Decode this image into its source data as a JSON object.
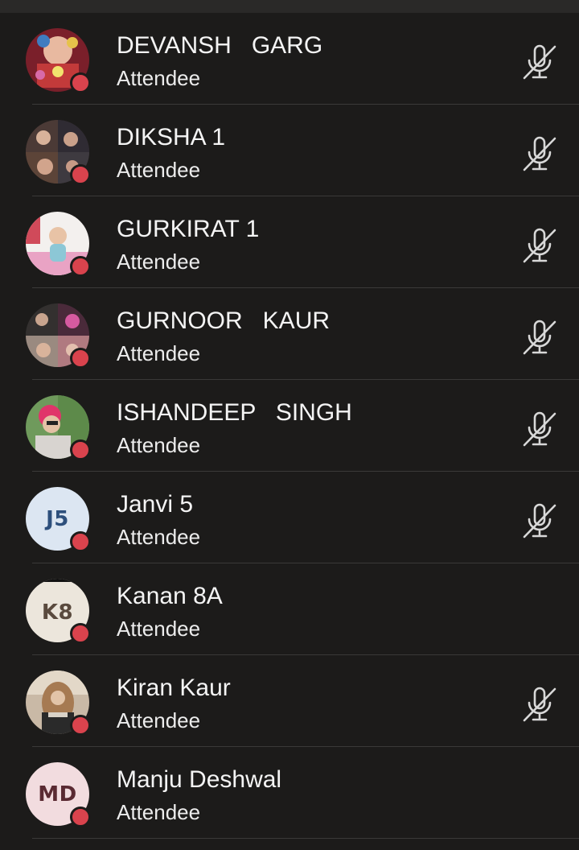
{
  "participants": [
    {
      "name": "DEVANSH   GARG",
      "role": "Attendee",
      "avatar": "photo",
      "status": "red",
      "mic": "mic-off-icon"
    },
    {
      "name": "DIKSHA 1",
      "role": "Attendee",
      "avatar": "photo",
      "status": "red",
      "mic": "mic-off-icon"
    },
    {
      "name": "GURKIRAT 1",
      "role": "Attendee",
      "avatar": "photo",
      "status": "red",
      "mic": "mic-off-icon"
    },
    {
      "name": "GURNOOR   KAUR",
      "role": "Attendee",
      "avatar": "photo",
      "status": "red",
      "mic": "mic-off-icon"
    },
    {
      "name": "ISHANDEEP   SINGH",
      "role": "Attendee",
      "avatar": "photo",
      "status": "red",
      "mic": "mic-off-icon"
    },
    {
      "name": "Janvi 5",
      "role": "Attendee",
      "initials": "J5",
      "initials_bg": "#dce6f2",
      "initials_color": "#2d4f7c",
      "status": "red",
      "mic": "mic-off-icon"
    },
    {
      "name": "Kanan 8A",
      "role": "Attendee",
      "initials": "K8",
      "initials_bg": "#ece6dc",
      "initials_color": "#5a4a3e",
      "status": "red"
    },
    {
      "name": "Kiran Kaur",
      "role": "Attendee",
      "avatar": "photo",
      "status": "red",
      "mic": "mic-off-icon"
    },
    {
      "name": "Manju Deshwal",
      "role": "Attendee",
      "initials": "MD",
      "initials_bg": "#f2dcdf",
      "initials_color": "#5a2a32",
      "status": "red"
    }
  ],
  "colors": {
    "background": "#1c1b1a",
    "divider": "#3a3938",
    "status_dot": "#d9434d",
    "mic_icon": "#d8d8d8"
  }
}
